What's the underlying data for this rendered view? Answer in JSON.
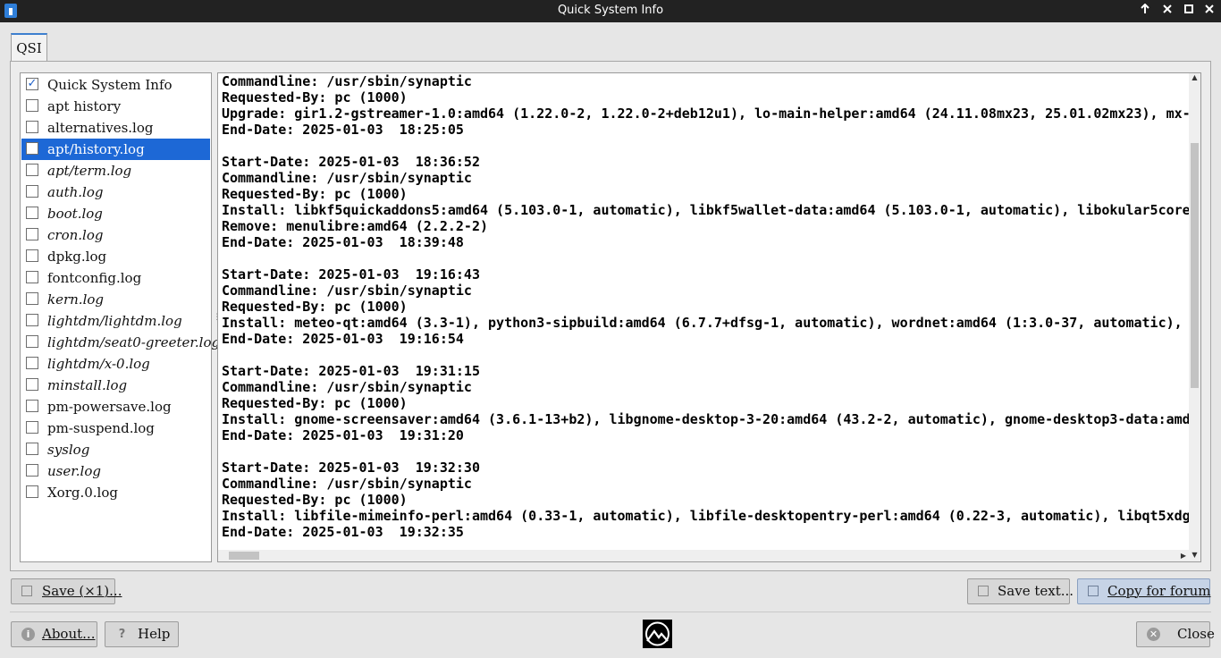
{
  "window": {
    "title": "Quick System Info",
    "controls": [
      "↑",
      "✕",
      "□",
      "✕"
    ]
  },
  "tabs": [
    {
      "label": "QSI"
    }
  ],
  "list": {
    "items": [
      {
        "label": "Quick System Info",
        "checked": true,
        "italic": false,
        "selected": false
      },
      {
        "label": "apt history",
        "checked": false,
        "italic": false,
        "selected": false
      },
      {
        "label": "alternatives.log",
        "checked": false,
        "italic": false,
        "selected": false
      },
      {
        "label": "apt/history.log",
        "checked": false,
        "italic": false,
        "selected": true
      },
      {
        "label": "apt/term.log",
        "checked": false,
        "italic": true,
        "selected": false
      },
      {
        "label": "auth.log",
        "checked": false,
        "italic": true,
        "selected": false
      },
      {
        "label": "boot.log",
        "checked": false,
        "italic": true,
        "selected": false
      },
      {
        "label": "cron.log",
        "checked": false,
        "italic": true,
        "selected": false
      },
      {
        "label": "dpkg.log",
        "checked": false,
        "italic": false,
        "selected": false
      },
      {
        "label": "fontconfig.log",
        "checked": false,
        "italic": false,
        "selected": false
      },
      {
        "label": "kern.log",
        "checked": false,
        "italic": true,
        "selected": false
      },
      {
        "label": "lightdm/lightdm.log",
        "checked": false,
        "italic": true,
        "selected": false
      },
      {
        "label": "lightdm/seat0-greeter.log",
        "checked": false,
        "italic": true,
        "selected": false
      },
      {
        "label": "lightdm/x-0.log",
        "checked": false,
        "italic": true,
        "selected": false
      },
      {
        "label": "minstall.log",
        "checked": false,
        "italic": true,
        "selected": false
      },
      {
        "label": "pm-powersave.log",
        "checked": false,
        "italic": false,
        "selected": false
      },
      {
        "label": "pm-suspend.log",
        "checked": false,
        "italic": false,
        "selected": false
      },
      {
        "label": "syslog",
        "checked": false,
        "italic": true,
        "selected": false
      },
      {
        "label": "user.log",
        "checked": false,
        "italic": true,
        "selected": false
      },
      {
        "label": "Xorg.0.log",
        "checked": false,
        "italic": false,
        "selected": false
      }
    ]
  },
  "log": {
    "lines": [
      "Commandline: /usr/sbin/synaptic",
      "Requested-By: pc (1000)",
      "Upgrade: gir1.2-gstreamer-1.0:amd64 (1.22.0-2, 1.22.0-2+deb12u1), lo-main-helper:amd64 (24.11.08mx23, 25.01.02mx23), mx-",
      "End-Date: 2025-01-03  18:25:05",
      "",
      "Start-Date: 2025-01-03  18:36:52",
      "Commandline: /usr/sbin/synaptic",
      "Requested-By: pc (1000)",
      "Install: libkf5quickaddons5:amd64 (5.103.0-1, automatic), libkf5wallet-data:amd64 (5.103.0-1, automatic), libokular5core",
      "Remove: menulibre:amd64 (2.2.2-2)",
      "End-Date: 2025-01-03  18:39:48",
      "",
      "Start-Date: 2025-01-03  19:16:43",
      "Commandline: /usr/sbin/synaptic",
      "Requested-By: pc (1000)",
      "Install: meteo-qt:amd64 (3.3-1), python3-sipbuild:amd64 (6.7.7+dfsg-1, automatic), wordnet:amd64 (1:3.0-37, automatic), ",
      "End-Date: 2025-01-03  19:16:54",
      "",
      "Start-Date: 2025-01-03  19:31:15",
      "Commandline: /usr/sbin/synaptic",
      "Requested-By: pc (1000)",
      "Install: gnome-screensaver:amd64 (3.6.1-13+b2), libgnome-desktop-3-20:amd64 (43.2-2, automatic), gnome-desktop3-data:amd",
      "End-Date: 2025-01-03  19:31:20",
      "",
      "Start-Date: 2025-01-03  19:32:30",
      "Commandline: /usr/sbin/synaptic",
      "Requested-By: pc (1000)",
      "Install: libfile-mimeinfo-perl:amd64 (0.33-1, automatic), libfile-desktopentry-perl:amd64 (0.22-3, automatic), libqt5xdg",
      "End-Date: 2025-01-03  19:32:35"
    ]
  },
  "buttons": {
    "save": "Save (×1)...",
    "save_text": "Save text...",
    "copy_forum": "Copy for forum",
    "about": "About...",
    "help": "Help",
    "close": "Close"
  },
  "icons": {
    "save": "floppy-icon",
    "copy": "copy-icon",
    "about": "info-icon",
    "help": "help-icon",
    "close": "close-icon",
    "logo": "mx-logo"
  },
  "colors": {
    "selection": "#1d68d6",
    "titlebar": "#222222",
    "accent_button": "#c6d3e6"
  }
}
